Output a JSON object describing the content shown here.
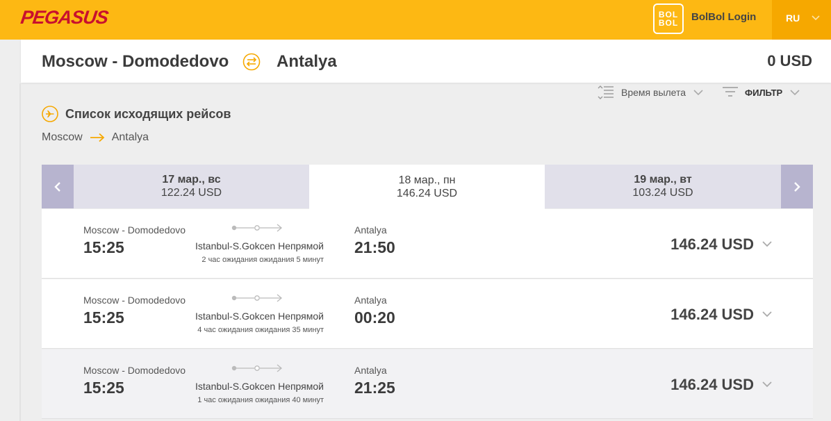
{
  "header": {
    "logo": "PEGASUS",
    "bolbol_badge_top": "BOL",
    "bolbol_badge_bottom": "BOL",
    "bolbol_login": "BolBol Login",
    "language": "RU"
  },
  "route": {
    "from": "Moscow - Domodedovo",
    "to": "Antalya",
    "total": "0 USD"
  },
  "controls": {
    "sort_label": "Время вылета",
    "filter_label": "ФИЛЬТР"
  },
  "list": {
    "title": "Список исходящих рейсов",
    "crumb_from": "Moscow",
    "crumb_to": "Antalya"
  },
  "dates": [
    {
      "date": "17 мар., вс",
      "price": "122.24 USD"
    },
    {
      "date": "18 мар., пн",
      "price": "146.24 USD"
    },
    {
      "date": "19 мар., вт",
      "price": "103.24 USD"
    }
  ],
  "flights": [
    {
      "from": "Moscow - Domodedovo",
      "dep": "15:25",
      "stop": "Istanbul-S.Gokcen Непрямой",
      "wait": "2 час ожидания ожидания 5 минут",
      "to": "Antalya",
      "arr": "21:50",
      "price": "146.24 USD"
    },
    {
      "from": "Moscow - Domodedovo",
      "dep": "15:25",
      "stop": "Istanbul-S.Gokcen Непрямой",
      "wait": "4 час ожидания ожидания 35 минут",
      "to": "Antalya",
      "arr": "00:20",
      "price": "146.24 USD"
    },
    {
      "from": "Moscow - Domodedovo",
      "dep": "15:25",
      "stop": "Istanbul-S.Gokcen Непрямой",
      "wait": "1 час ожидания ожидания 40 минут",
      "to": "Antalya",
      "arr": "21:25",
      "price": "146.24 USD"
    }
  ],
  "colors": {
    "brand_yellow": "#fdb813",
    "brand_red": "#c8102e",
    "nav_purple": "#b7b4cf"
  }
}
